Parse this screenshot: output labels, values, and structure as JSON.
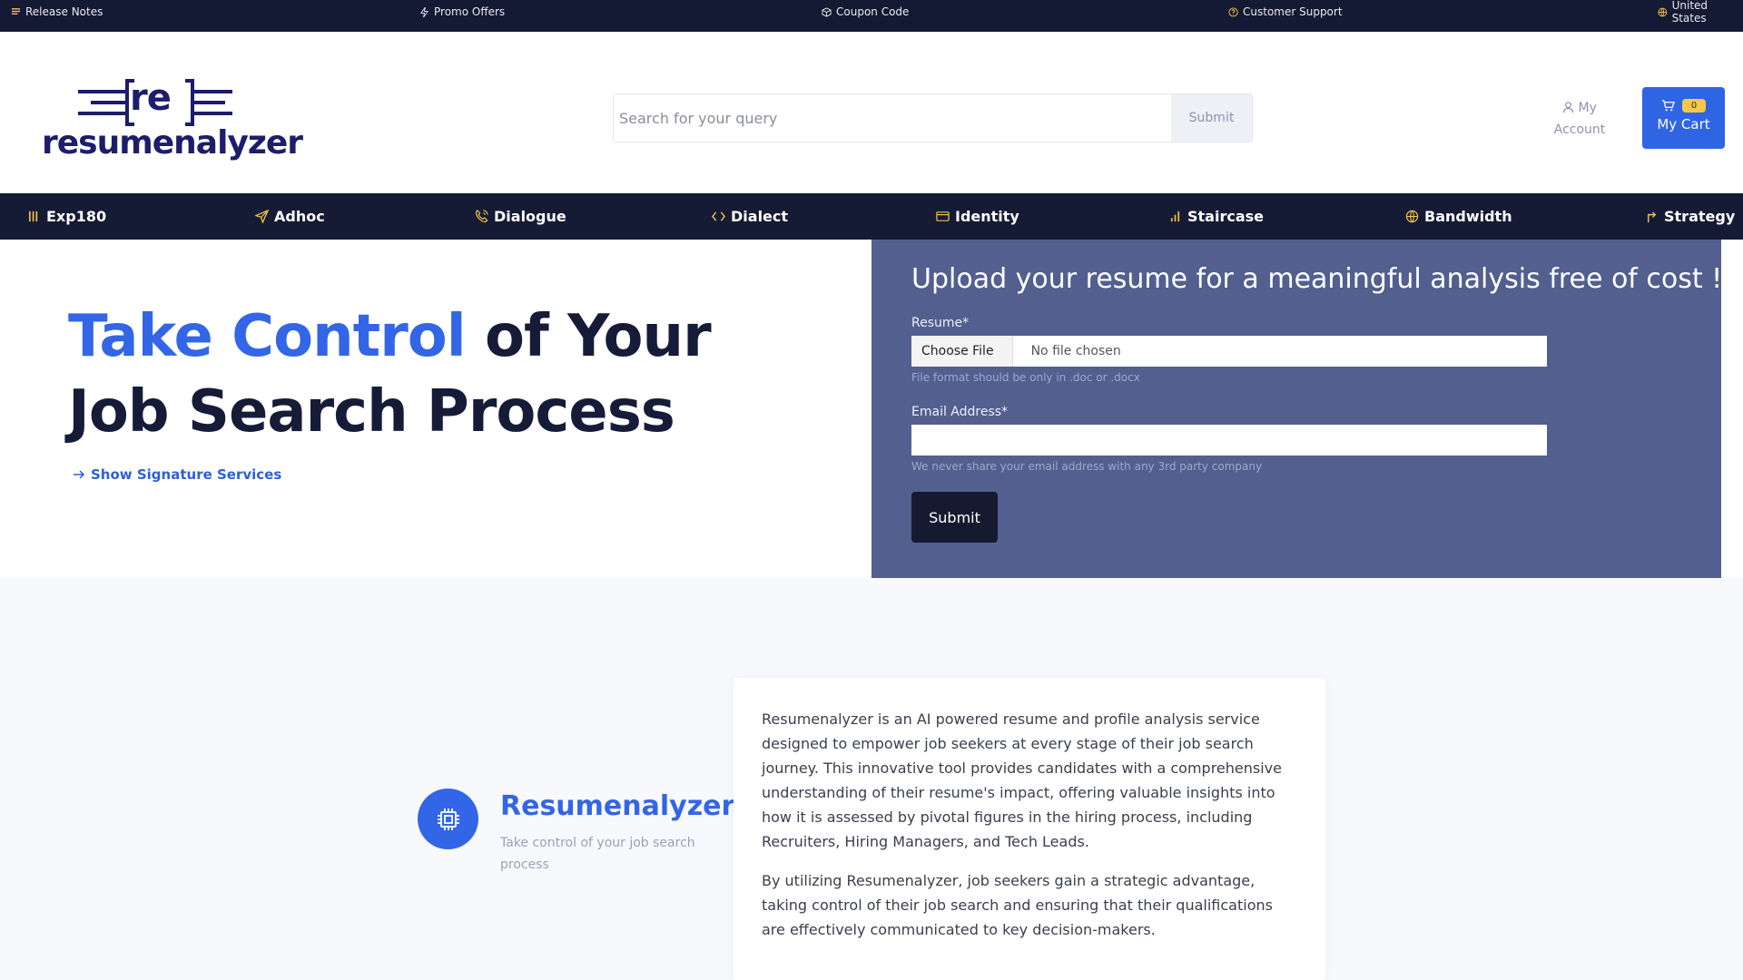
{
  "topbar": {
    "items": [
      {
        "label": "Release Notes",
        "icon": "notes-icon"
      },
      {
        "label": "Promo Offers",
        "icon": "bolt-icon"
      },
      {
        "label": "Coupon Code",
        "icon": "box-icon"
      },
      {
        "label": "Customer Support",
        "icon": "help-icon"
      },
      {
        "label": "United States",
        "icon": "globe-icon"
      }
    ]
  },
  "header": {
    "logo": {
      "mark_text": "re",
      "wordmark": "resumenalyzer"
    },
    "search": {
      "placeholder": "Search for your query",
      "submit_label": "Submit"
    },
    "account": {
      "line1": "My",
      "line2": "Account"
    },
    "cart": {
      "count": "0",
      "label": "My Cart"
    }
  },
  "nav": {
    "items": [
      {
        "label": "Exp180",
        "icon": "columns-icon"
      },
      {
        "label": "Adhoc",
        "icon": "send-icon"
      },
      {
        "label": "Dialogue",
        "icon": "phone-call-icon"
      },
      {
        "label": "Dialect",
        "icon": "code-icon"
      },
      {
        "label": "Identity",
        "icon": "id-card-icon"
      },
      {
        "label": "Staircase",
        "icon": "bar-chart-icon"
      },
      {
        "label": "Bandwidth",
        "icon": "globe-icon"
      },
      {
        "label": "Strategy",
        "icon": "corner-up-icon"
      }
    ]
  },
  "hero": {
    "title_accent": "Take Control",
    "title_rest": " of Your Job Search Process",
    "link_label": "Show Signature Services"
  },
  "upload": {
    "heading": "Upload your resume for a meaningful analysis free of cost !!!",
    "resume_label": "Resume*",
    "choose_file": "Choose File",
    "no_file": "No file chosen",
    "resume_hint": "File format should be only in .doc or .docx",
    "email_label": "Email Address*",
    "email_value": "",
    "email_hint": "We never share your email address with any 3rd party company",
    "submit_label": "Submit"
  },
  "about": {
    "feature_title": "Resumenalyzer",
    "feature_subtitle": "Take control of your job search process",
    "paragraph1": "Resumenalyzer is an AI powered resume and profile analysis service designed to empower job seekers at every stage of their job search journey. This innovative tool provides candidates with a comprehensive understanding of their resume's impact, offering valuable insights into how it is assessed by pivotal figures in the hiring process, including Recruiters, Hiring Managers, and Tech Leads.",
    "paragraph2": "By utilizing Resumenalyzer, job seekers gain a strategic advantage, taking control of their job search and ensuring that their qualifications are effectively communicated to key decision-makers."
  },
  "colors": {
    "topbar_bg": "#141a33",
    "nav_bg": "#151b35",
    "accent": "#3366e6",
    "upload_panel_bg": "#525f8f",
    "cart_bg": "#2f64e4",
    "badge_bg": "#f8c84a"
  }
}
